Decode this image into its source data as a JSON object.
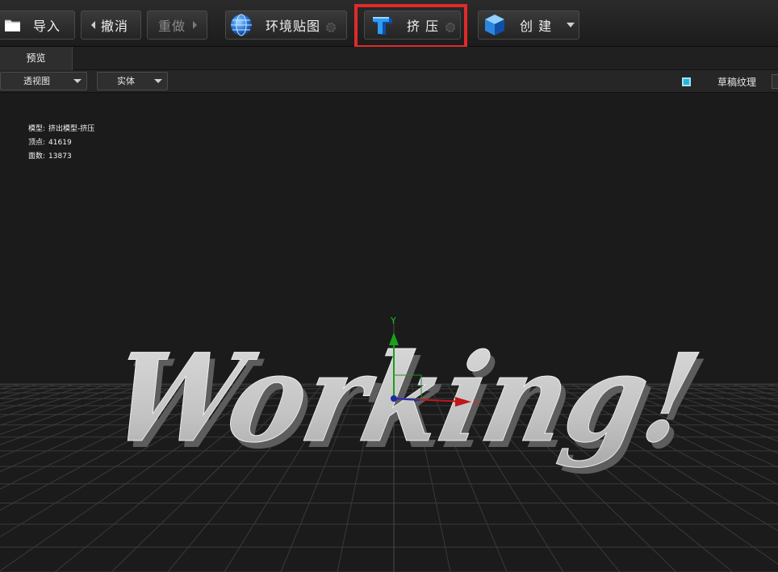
{
  "toolbar": {
    "import_label": "导入",
    "undo_label": "撤消",
    "redo_label": "重做",
    "envmap_label": "环境贴图",
    "extrude_label": "挤 压",
    "create_label": "创 建"
  },
  "tabs": [
    {
      "label": "预览"
    }
  ],
  "subbar": {
    "view_mode": "透视图",
    "shading_mode": "实体",
    "draft_texture_label": "草稿纹理"
  },
  "viewport": {
    "stats": [
      {
        "key": "模型:",
        "value": "挤出模型-挤压"
      },
      {
        "key": "顶点:",
        "value": "41619"
      },
      {
        "key": "面数:",
        "value": "13873"
      }
    ],
    "model_text": "Working!",
    "axis_labels": {
      "x": "X",
      "y": "Y"
    }
  },
  "colors": {
    "highlight": "#e02a2a",
    "checkbox": "#27b3d8",
    "axis_x": "#c01818",
    "axis_y": "#1aa01a",
    "axis_z": "#2030c0"
  }
}
